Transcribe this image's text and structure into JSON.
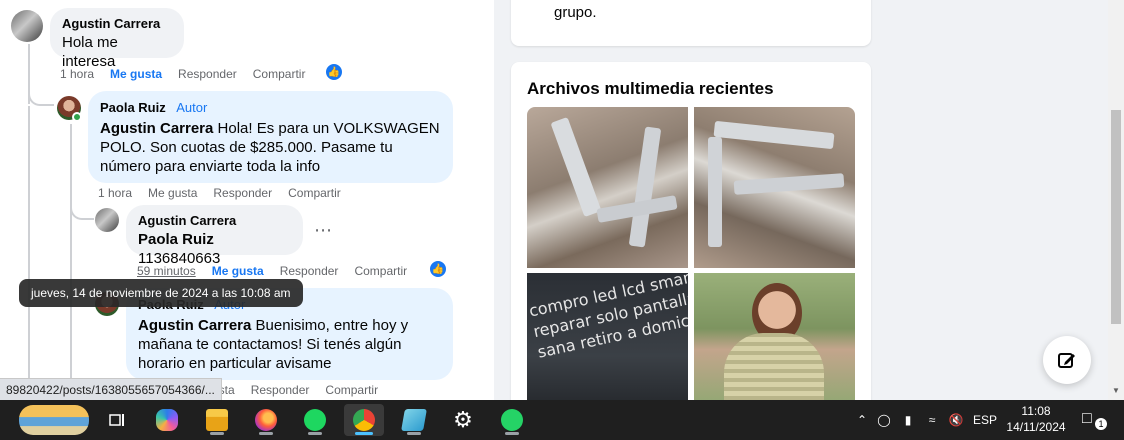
{
  "comments": [
    {
      "author": "Agustin Carrera",
      "text": "Hola me interesa",
      "time": "1 hora",
      "like_label": "Me gusta",
      "reply_label": "Responder",
      "share_label": "Compartir"
    },
    {
      "author": "Paola Ruiz",
      "tag": "Autor",
      "mention": "Agustin Carrera",
      "text": " Hola! Es para un VOLKSWAGEN POLO. Son cuotas de $285.000. Pasame tu número para enviarte toda la info",
      "time": "1 hora",
      "like_label": "Me gusta",
      "reply_label": "Responder",
      "share_label": "Compartir"
    },
    {
      "author": "Agustin Carrera",
      "mention": "Paola Ruiz",
      "text": " 1136840663",
      "time": "59 minutos",
      "like_label": "Me gusta",
      "reply_label": "Responder",
      "share_label": "Compartir"
    },
    {
      "author": "Paola Ruiz",
      "tag": "Autor",
      "mention": "Agustin Carrera",
      "text": " Buenisimo, entre hoy y mañana te contactamos! Si tenés algún horario en particular avisame",
      "time_partial": "usta",
      "reply_label": "Responder",
      "share_label": "Compartir"
    }
  ],
  "tooltip": "jueves, 14 de noviembre de 2024 a las 10:08 am",
  "status_url": "89820422/posts/1638055657054366/...",
  "right": {
    "top_card_text": "grupo.",
    "media_title": "Archivos multimedia recientes",
    "media_overlay_text": [
      "compro led lcd smart a",
      "reparar solo pantalla",
      "sana retiro a domicilio"
    ]
  },
  "taskbar": {
    "language": "ESP",
    "time": "11:08",
    "date": "14/11/2024",
    "notification_count": "1"
  },
  "colors": {
    "accent": "#1877f2",
    "author_bubble": "#e7f3ff",
    "bubble": "#f0f2f5",
    "taskbar": "#1f1f1f"
  }
}
